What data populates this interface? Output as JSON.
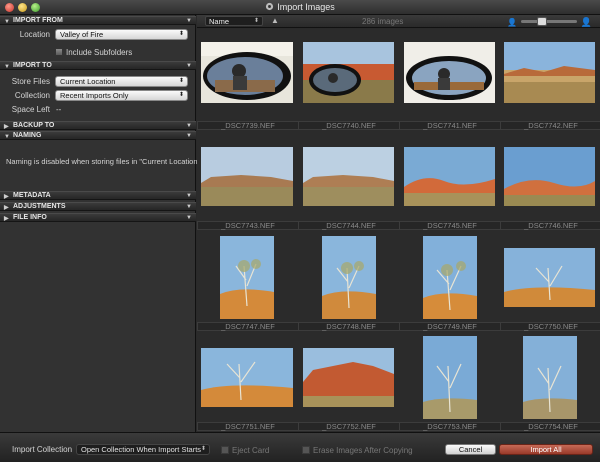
{
  "window": {
    "title": "Import Images"
  },
  "left_panel": {
    "import_from": {
      "header": "IMPORT FROM",
      "location_label": "Location",
      "location_value": "Valley of Fire",
      "include_subfolders_label": "Include Subfolders"
    },
    "import_to": {
      "header": "IMPORT TO",
      "store_files_label": "Store Files",
      "store_files_value": "Current Location",
      "collection_label": "Collection",
      "collection_value": "Recent Imports Only",
      "space_left_label": "Space Left",
      "space_left_value": "--"
    },
    "backup_to": {
      "header": "BACKUP TO"
    },
    "naming": {
      "header": "NAMING",
      "message": "Naming is disabled when storing files in \"Current Location\""
    },
    "metadata": {
      "header": "METADATA"
    },
    "adjustments": {
      "header": "ADJUSTMENTS"
    },
    "file_info": {
      "header": "FILE INFO"
    }
  },
  "toolbar": {
    "sort_value": "Name",
    "image_count": "286 images"
  },
  "thumbnails": [
    {
      "filename": "_DSC7739.NEF"
    },
    {
      "filename": "_DSC7740.NEF"
    },
    {
      "filename": "_DSC7741.NEF"
    },
    {
      "filename": "_DSC7742.NEF"
    },
    {
      "filename": "_DSC7743.NEF"
    },
    {
      "filename": "_DSC7744.NEF"
    },
    {
      "filename": "_DSC7745.NEF"
    },
    {
      "filename": "_DSC7746.NEF"
    },
    {
      "filename": "_DSC7747.NEF"
    },
    {
      "filename": "_DSC7748.NEF"
    },
    {
      "filename": "_DSC7749.NEF"
    },
    {
      "filename": "_DSC7750.NEF"
    },
    {
      "filename": "_DSC7751.NEF"
    },
    {
      "filename": "_DSC7752.NEF"
    },
    {
      "filename": "_DSC7753.NEF"
    },
    {
      "filename": "_DSC7754.NEF"
    }
  ],
  "bottom_bar": {
    "import_collection_label": "Import Collection",
    "import_collection_value": "Open Collection When Import Starts",
    "eject_card_label": "Eject Card",
    "erase_images_label": "Erase Images After Copying",
    "cancel_label": "Cancel",
    "import_all_label": "Import All"
  },
  "colors": {
    "accent_import": "#b04a36",
    "panel_bg": "#323232",
    "grid_bg": "#2b2b2b"
  }
}
